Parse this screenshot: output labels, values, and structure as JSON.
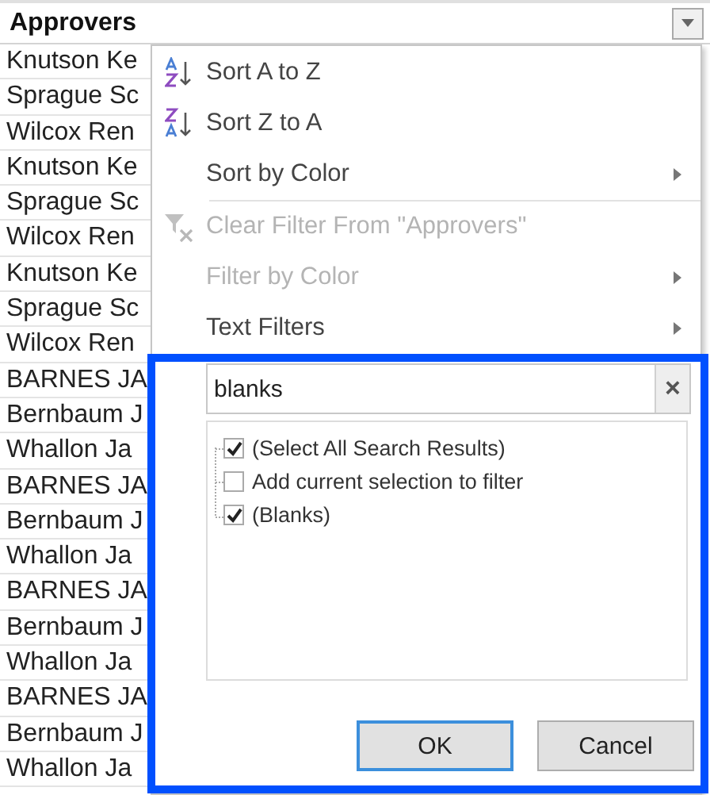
{
  "sheet": {
    "header": "Approvers",
    "rows": [
      "Knutson Ke",
      "Sprague Sc",
      "Wilcox Ren",
      "Knutson Ke",
      "Sprague Sc",
      "Wilcox Ren",
      "Knutson Ke",
      "Sprague Sc",
      "Wilcox Ren",
      "BARNES JA",
      "Bernbaum J",
      "Whallon Ja",
      "BARNES JA",
      "Bernbaum J",
      "Whallon Ja",
      "BARNES JA",
      "Bernbaum J",
      "Whallon Ja",
      "BARNES JA",
      "Bernbaum J",
      "Whallon Ja"
    ]
  },
  "menu": {
    "items": [
      {
        "label": "Sort A to Z",
        "kind": "sort-asc",
        "disabled": false,
        "submenu": false
      },
      {
        "label": "Sort Z to A",
        "kind": "sort-desc",
        "disabled": false,
        "submenu": false
      },
      {
        "label": "Sort by Color",
        "kind": "plain",
        "disabled": false,
        "submenu": true,
        "separator_after": true
      },
      {
        "label": "Clear Filter From \"Approvers\"",
        "kind": "clear-filter",
        "disabled": true,
        "submenu": false
      },
      {
        "label": "Filter by Color",
        "kind": "plain",
        "disabled": true,
        "submenu": true
      },
      {
        "label": "Text Filters",
        "kind": "plain",
        "disabled": false,
        "submenu": true
      }
    ],
    "search": {
      "value": "blanks",
      "clear": "×"
    },
    "options": [
      {
        "label": "(Select All Search Results)",
        "checked": true
      },
      {
        "label": "Add current selection to filter",
        "checked": false
      },
      {
        "label": "(Blanks)",
        "checked": true
      }
    ],
    "buttons": [
      {
        "label": "OK",
        "default": true
      },
      {
        "label": "Cancel",
        "default": false
      }
    ]
  },
  "highlight": {
    "shown": true
  }
}
